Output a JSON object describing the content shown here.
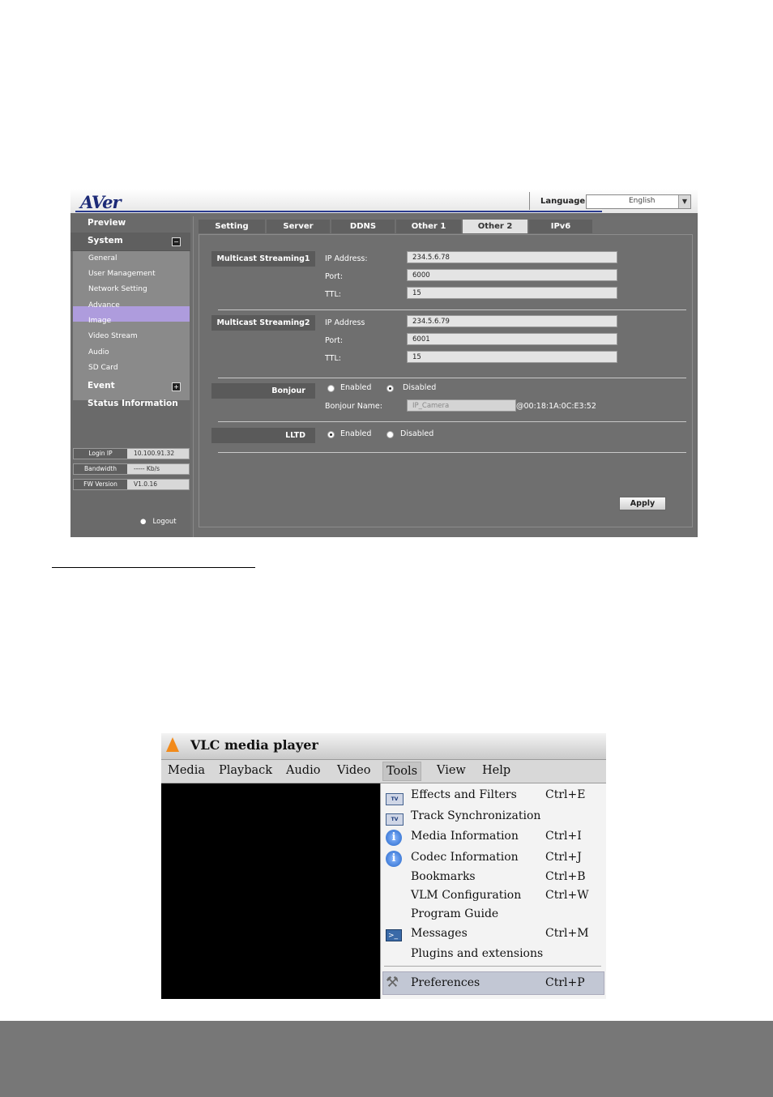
{
  "aver": {
    "logo": "AVer",
    "language_label": "Language",
    "language_value": "English",
    "sidebar": {
      "preview": "Preview",
      "system": "System",
      "system_toggle": "−",
      "items": [
        "General",
        "User Management",
        "Network Setting",
        "Advance",
        "Image",
        "Video Stream",
        "Audio",
        "SD Card"
      ],
      "active_item": "Network Setting",
      "event": "Event",
      "event_toggle": "+",
      "status": "Status Information",
      "info": [
        {
          "key": "Login IP",
          "value": "10.100.91.32"
        },
        {
          "key": "Bandwidth",
          "value": "----- Kb/s"
        },
        {
          "key": "FW Version",
          "value": "V1.0.16"
        }
      ],
      "logout": "Logout"
    },
    "tabs": [
      "Setting",
      "Server",
      "DDNS",
      "Other 1",
      "Other 2",
      "IPv6"
    ],
    "active_tab": "Other 2",
    "multicast1": {
      "title": "Multicast Streaming1",
      "ip_label": "IP Address:",
      "ip": "234.5.6.78",
      "port_label": "Port:",
      "port": "6000",
      "ttl_label": "TTL:",
      "ttl": "15"
    },
    "multicast2": {
      "title": "Multicast Streaming2",
      "ip_label": "IP Address",
      "ip": "234.5.6.79",
      "port_label": "Port:",
      "port": "6001",
      "ttl_label": "TTL:",
      "ttl": "15"
    },
    "bonjour": {
      "title": "Bonjour",
      "enabled": "Enabled",
      "disabled": "Disabled",
      "selected": "Disabled",
      "name_label": "Bonjour Name:",
      "name_value": "IP_Camera",
      "mac_suffix": "@00:18:1A:0C:E3:52"
    },
    "lltd": {
      "title": "LLTD",
      "enabled": "Enabled",
      "disabled": "Disabled",
      "selected": "Enabled"
    },
    "apply": "Apply"
  },
  "vlc": {
    "title": "VLC media player",
    "menus": [
      "Media",
      "Playback",
      "Audio",
      "Video",
      "Tools",
      "View",
      "Help"
    ],
    "active_menu": "Tools",
    "tools_items": [
      {
        "label": "Effects and Filters",
        "shortcut": "Ctrl+E",
        "icon": "effects-icon"
      },
      {
        "label": "Track Synchronization",
        "shortcut": "",
        "icon": "sync-icon"
      },
      {
        "label": "Media Information",
        "shortcut": "Ctrl+I",
        "icon": "info-icon"
      },
      {
        "label": "Codec Information",
        "shortcut": "Ctrl+J",
        "icon": "info-icon"
      },
      {
        "label": "Bookmarks",
        "shortcut": "Ctrl+B",
        "icon": ""
      },
      {
        "label": "VLM Configuration",
        "shortcut": "Ctrl+W",
        "icon": ""
      },
      {
        "label": "Program Guide",
        "shortcut": "",
        "icon": ""
      },
      {
        "label": "Messages",
        "shortcut": "Ctrl+M",
        "icon": "terminal-icon"
      },
      {
        "label": "Plugins and extensions",
        "shortcut": "",
        "icon": ""
      }
    ],
    "preferences": {
      "label": "Preferences",
      "shortcut": "Ctrl+P",
      "icon": "tools-icon"
    }
  }
}
